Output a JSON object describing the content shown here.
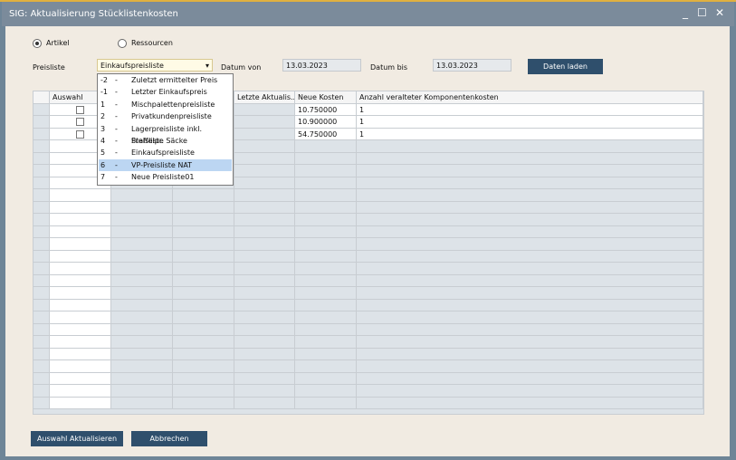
{
  "window": {
    "title": "SIG: Aktualisierung Stücklistenkosten",
    "minimize": "_",
    "maximize": "☐",
    "close": "✕"
  },
  "mode": {
    "artikel": "Artikel",
    "ressourcen": "Ressourcen",
    "selected": "Artikel"
  },
  "form": {
    "preisliste_label": "Preisliste",
    "preisliste_value": "Einkaufspreisliste",
    "datum_von_label": "Datum von",
    "datum_von": "13.03.2023",
    "datum_bis_label": "Datum bis",
    "datum_bis": "13.03.2023",
    "load_button": "Daten laden"
  },
  "dropdown": {
    "options": [
      {
        "code": "-2",
        "name": "Zuletzt ermittelter Preis"
      },
      {
        "code": "-1",
        "name": "Letzter Einkaufspreis"
      },
      {
        "code": "1",
        "name": "Mischpalettenpreisliste"
      },
      {
        "code": "2",
        "name": "Privatkundenpreisliste"
      },
      {
        "code": "3",
        "name": "Lagerpreisliste inkl. Staffelpr."
      },
      {
        "code": "4",
        "name": "Preisliste Säcke"
      },
      {
        "code": "5",
        "name": "Einkaufspreisliste"
      },
      {
        "code": "6",
        "name": "VP-Preisliste NAT"
      },
      {
        "code": "7",
        "name": "Neue Preisliste01"
      }
    ],
    "highlighted": "6",
    "separator": "-"
  },
  "table": {
    "columns": [
      "Auswahl",
      "",
      "",
      "Letzte Aktualis...",
      "Neue Kosten",
      "Anzahl veralteter Komponentenkosten"
    ],
    "rows": [
      {
        "neue_kosten": "10.750000",
        "anzahl": "1"
      },
      {
        "neue_kosten": "10.900000",
        "anzahl": "1"
      },
      {
        "neue_kosten": "54.750000",
        "anzahl": "1"
      }
    ]
  },
  "footer": {
    "update_button": "Auswahl Aktualisieren",
    "cancel_button": "Abbrechen"
  }
}
